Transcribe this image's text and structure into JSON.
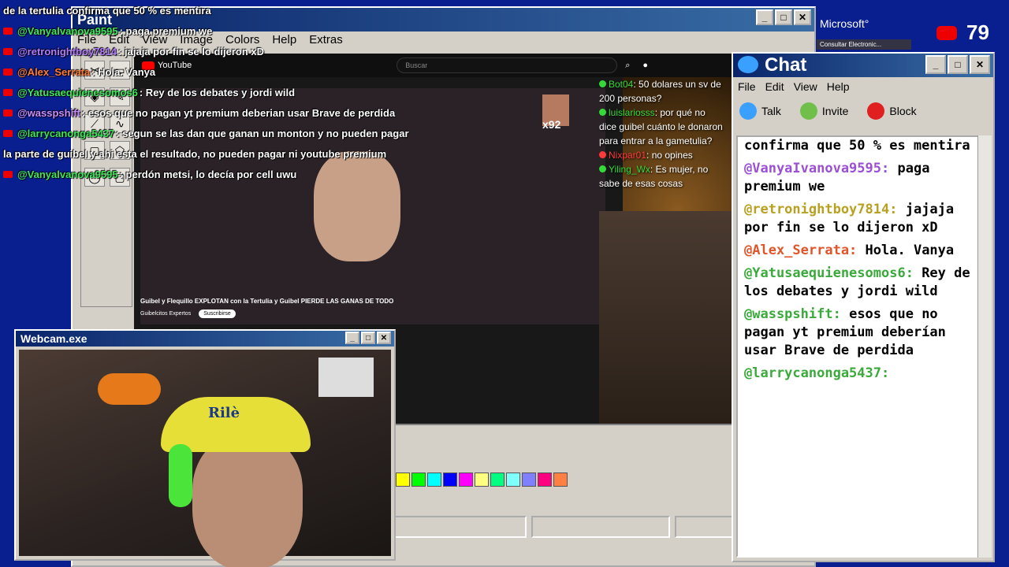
{
  "overlay": {
    "lines": [
      {
        "user": "",
        "text": "de la tertulia confirma que 50 % es mentira"
      },
      {
        "user": "@Vanyalvanova9595",
        "text": ": paga premium we"
      },
      {
        "user": "@retronightboy7814",
        "text": ": jajaja por fin se lo dijeron xD"
      },
      {
        "user": "@Alex_Serrata",
        "text": ": Hola. Vanya"
      },
      {
        "user": "@Yatusaequienesomos6",
        "text": ": Rey de los debates y jordi wild"
      },
      {
        "user": "@wasspshift",
        "text": ": esos que no pagan yt premium deberian usar Brave de perdida"
      },
      {
        "user": "@larrycanonga5437",
        "text": ": segun se las dan que ganan un monton y no pueden pagar"
      },
      {
        "user": "",
        "text": "la parte de guibel y ahi esta el resultado, no pueden pagar ni youtube premium"
      },
      {
        "user": "@Vanyalvanova9595",
        "text": ": perdón metsi, lo decía por cell uwu"
      }
    ],
    "user_colors": [
      "#ffffff",
      "#3ee65a",
      "#b27bff",
      "#ff7a3a",
      "#3ee65a",
      "#c88cff",
      "#3ee65a",
      "#ffffff",
      "#3ee65a"
    ]
  },
  "paint": {
    "title": "Paint",
    "menu": [
      "File",
      "Edit",
      "View",
      "Image",
      "Colors",
      "Help",
      "Extras"
    ],
    "palette": [
      "#ffff00",
      "#00ff00",
      "#00ffff",
      "#0000ff",
      "#ff00ff",
      "#ffff80",
      "#00ff80",
      "#80ffff",
      "#8080ff",
      "#ff0080",
      "#ff8040"
    ]
  },
  "youtube": {
    "logo": "YouTube",
    "search_placeholder": "Buscar",
    "video_title": "Guibel y Flequillo EXPLOTAN con la Tertulia y Guibel PIERDE LAS GANAS DE TODO",
    "channel": "Guibelcitos Expertos",
    "subscribe": "Suscribirse",
    "counter": "x92",
    "chat": [
      {
        "user": "Bot04",
        "text": ": 50 dolares un sv de 200 personas?",
        "color": "#36d93a"
      },
      {
        "user": "luislariosss",
        "text": ": por qué no dice guibel cuánto le donaron para entrar a la gametulia?",
        "color": "#36d93a"
      },
      {
        "user": "Nixpar01",
        "text": ": no opines",
        "color": "#ff3a3a"
      },
      {
        "user": "Yiling_Wx",
        "text": ": Es mujer, no sabe de esas cosas",
        "color": "#36d93a"
      }
    ]
  },
  "webcam": {
    "title": "Webcam.exe",
    "cap_text": "Rilè"
  },
  "chat": {
    "title": "Chat",
    "menu": [
      "File",
      "Edit",
      "View",
      "Help"
    ],
    "tools": [
      {
        "label": "Talk",
        "icon": "talk-icon",
        "color": "#3aa0ff"
      },
      {
        "label": "Invite",
        "icon": "invite-icon",
        "color": "#6fbf4a"
      },
      {
        "label": "Block",
        "icon": "block-icon",
        "color": "#e02020"
      }
    ],
    "messages": [
      {
        "user": "",
        "text": "confirma que 50 % es mentira",
        "color": "#000000"
      },
      {
        "user": "@VanyaIvanova9595:",
        "text": "paga premium we",
        "color": "#9b4fd6"
      },
      {
        "user": "@retronightboy7814:",
        "text": "jajaja por fin se lo dijeron xD",
        "color": "#b8a020"
      },
      {
        "user": "@Alex_Serrata:",
        "text": "Hola. Vanya",
        "color": "#e0552a"
      },
      {
        "user": "@Yatusaequienesomos6:",
        "text": "Rey de los debates y jordi wild",
        "color": "#3aaa3a"
      },
      {
        "user": "@wasspshift:",
        "text": "esos que no pagan yt premium deberían usar Brave de perdida",
        "color": "#3aaa3a"
      },
      {
        "user": "@larrycanonga5437:",
        "text": "",
        "color": "#3aaa3a"
      }
    ]
  },
  "corner": {
    "brand": "Microsoft°",
    "sub": "Consultar Electronic...",
    "viewer_count": "79"
  }
}
